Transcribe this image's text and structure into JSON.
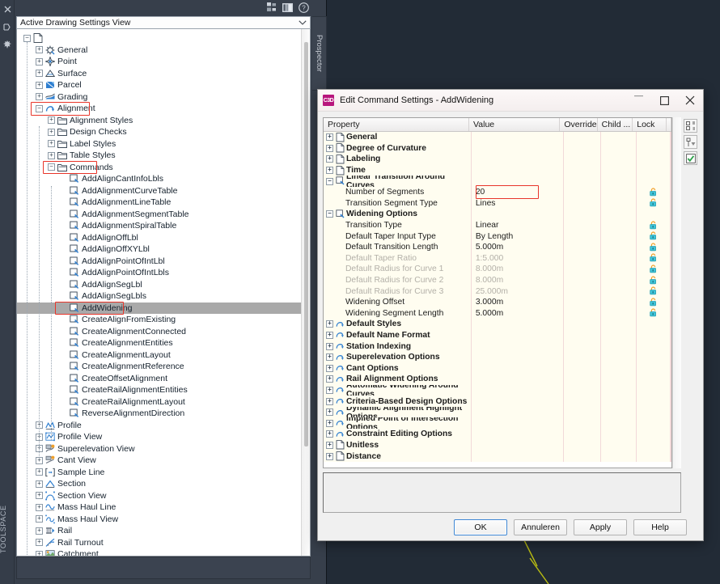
{
  "canvas": {
    "line_color": "#b9bc12"
  },
  "toolspace": {
    "vertical_label": "TOOLSPACE",
    "panel_tab": "Prospector",
    "left_icons": [
      "close-icon",
      "auto-hide-icon",
      "properties-icon"
    ],
    "title_icons": [
      "toolspace-panel-icon",
      "toolspace-view-icon",
      "help-icon"
    ],
    "view_selector": {
      "value": "Active Drawing Settings View",
      "arrow": "chevron-down-icon"
    },
    "tree": [
      {
        "label": "",
        "indent": 0,
        "expander": "minus",
        "icon": "drawing-icon",
        "blurred": true
      },
      {
        "label": "General",
        "indent": 1,
        "expander": "plus",
        "icon": "general-icon"
      },
      {
        "label": "Point",
        "indent": 1,
        "expander": "plus",
        "icon": "point-icon"
      },
      {
        "label": "Surface",
        "indent": 1,
        "expander": "plus",
        "icon": "surface-icon"
      },
      {
        "label": "Parcel",
        "indent": 1,
        "expander": "plus",
        "icon": "parcel-icon"
      },
      {
        "label": "Grading",
        "indent": 1,
        "expander": "plus",
        "icon": "grading-icon"
      },
      {
        "label": "Alignment",
        "indent": 1,
        "expander": "minus",
        "icon": "alignment-icon",
        "highlight": true
      },
      {
        "label": "Alignment Styles",
        "indent": 2,
        "expander": "plus",
        "icon": "folder-icon"
      },
      {
        "label": "Design Checks",
        "indent": 2,
        "expander": "plus",
        "icon": "folder-icon"
      },
      {
        "label": "Label Styles",
        "indent": 2,
        "expander": "plus",
        "icon": "folder-icon"
      },
      {
        "label": "Table Styles",
        "indent": 2,
        "expander": "plus",
        "icon": "folder-icon"
      },
      {
        "label": "Commands",
        "indent": 2,
        "expander": "minus",
        "icon": "folder-icon",
        "highlight": true
      },
      {
        "label": "AddAlignCantInfoLbls",
        "indent": 3,
        "expander": "none",
        "icon": "command-icon"
      },
      {
        "label": "AddAlignmentCurveTable",
        "indent": 3,
        "expander": "none",
        "icon": "command-icon"
      },
      {
        "label": "AddAlignmentLineTable",
        "indent": 3,
        "expander": "none",
        "icon": "command-icon"
      },
      {
        "label": "AddAlignmentSegmentTable",
        "indent": 3,
        "expander": "none",
        "icon": "command-icon"
      },
      {
        "label": "AddAlignmentSpiralTable",
        "indent": 3,
        "expander": "none",
        "icon": "command-icon"
      },
      {
        "label": "AddAlignOffLbl",
        "indent": 3,
        "expander": "none",
        "icon": "command-icon"
      },
      {
        "label": "AddAlignOffXYLbl",
        "indent": 3,
        "expander": "none",
        "icon": "command-icon"
      },
      {
        "label": "AddAlignPointOfIntLbl",
        "indent": 3,
        "expander": "none",
        "icon": "command-icon"
      },
      {
        "label": "AddAlignPointOfIntLbls",
        "indent": 3,
        "expander": "none",
        "icon": "command-icon"
      },
      {
        "label": "AddAlignSegLbl",
        "indent": 3,
        "expander": "none",
        "icon": "command-icon"
      },
      {
        "label": "AddAlignSegLbls",
        "indent": 3,
        "expander": "none",
        "icon": "command-icon"
      },
      {
        "label": "AddWidening",
        "indent": 3,
        "expander": "none",
        "icon": "command-icon",
        "selected": true,
        "highlight": true
      },
      {
        "label": "CreateAlignFromExisting",
        "indent": 3,
        "expander": "none",
        "icon": "command-icon"
      },
      {
        "label": "CreateAlignmentConnected",
        "indent": 3,
        "expander": "none",
        "icon": "command-icon"
      },
      {
        "label": "CreateAlignmentEntities",
        "indent": 3,
        "expander": "none",
        "icon": "command-icon"
      },
      {
        "label": "CreateAlignmentLayout",
        "indent": 3,
        "expander": "none",
        "icon": "command-icon"
      },
      {
        "label": "CreateAlignmentReference",
        "indent": 3,
        "expander": "none",
        "icon": "command-icon"
      },
      {
        "label": "CreateOffsetAlignment",
        "indent": 3,
        "expander": "none",
        "icon": "command-icon"
      },
      {
        "label": "CreateRailAlignmentEntities",
        "indent": 3,
        "expander": "none",
        "icon": "command-icon"
      },
      {
        "label": "CreateRailAlignmentLayout",
        "indent": 3,
        "expander": "none",
        "icon": "command-icon"
      },
      {
        "label": "ReverseAlignmentDirection",
        "indent": 3,
        "expander": "none",
        "icon": "command-icon"
      },
      {
        "label": "Profile",
        "indent": 1,
        "expander": "plus",
        "icon": "profile-icon"
      },
      {
        "label": "Profile View",
        "indent": 1,
        "expander": "plus",
        "icon": "profile-view-icon"
      },
      {
        "label": "Superelevation View",
        "indent": 1,
        "expander": "plus",
        "icon": "superelevation-view-icon"
      },
      {
        "label": "Cant View",
        "indent": 1,
        "expander": "plus",
        "icon": "cant-view-icon"
      },
      {
        "label": "Sample Line",
        "indent": 1,
        "expander": "plus",
        "icon": "sample-line-icon"
      },
      {
        "label": "Section",
        "indent": 1,
        "expander": "plus",
        "icon": "section-icon"
      },
      {
        "label": "Section View",
        "indent": 1,
        "expander": "plus",
        "icon": "section-view-icon"
      },
      {
        "label": "Mass Haul Line",
        "indent": 1,
        "expander": "plus",
        "icon": "mass-haul-line-icon"
      },
      {
        "label": "Mass Haul View",
        "indent": 1,
        "expander": "plus",
        "icon": "mass-haul-view-icon"
      },
      {
        "label": "Rail",
        "indent": 1,
        "expander": "plus",
        "icon": "rail-icon"
      },
      {
        "label": "Rail Turnout",
        "indent": 1,
        "expander": "plus",
        "icon": "rail-turnout-icon"
      },
      {
        "label": "Catchment",
        "indent": 1,
        "expander": "plus",
        "icon": "catchment-icon"
      }
    ]
  },
  "dialog": {
    "title": "Edit Command Settings - AddWidening",
    "app_badge": "C3D",
    "window_buttons": [
      {
        "name": "minimize-button",
        "glyph": "minimize-icon"
      },
      {
        "name": "maximize-button",
        "glyph": "maximize-icon"
      },
      {
        "name": "close-button",
        "glyph": "close-icon"
      }
    ],
    "columns": [
      "Property",
      "Value",
      "Override",
      "Child ...",
      "Lock"
    ],
    "rows": [
      {
        "property": "General",
        "value": "",
        "level": "cat",
        "expander": "plus",
        "icon": "page-icon"
      },
      {
        "property": "Degree of Curvature",
        "value": "",
        "level": "cat",
        "expander": "plus",
        "icon": "page-icon"
      },
      {
        "property": "Labeling",
        "value": "",
        "level": "cat",
        "expander": "plus",
        "icon": "page-icon"
      },
      {
        "property": "Time",
        "value": "",
        "level": "cat",
        "expander": "plus",
        "icon": "page-icon"
      },
      {
        "property": "Linear Transition Around Curves",
        "value": "",
        "level": "cat",
        "expander": "minus",
        "icon": "command-page-icon"
      },
      {
        "property": "Number of Segments",
        "value": "20",
        "level": "item",
        "lock": true,
        "value_highlight": true
      },
      {
        "property": "Transition Segment Type",
        "value": "Lines",
        "level": "item",
        "lock": true
      },
      {
        "property": "Widening Options",
        "value": "",
        "level": "cat",
        "expander": "minus",
        "icon": "command-page-icon"
      },
      {
        "property": "Transition Type",
        "value": "Linear",
        "level": "item",
        "lock": true
      },
      {
        "property": "Default Taper Input Type",
        "value": "By Length",
        "level": "item",
        "lock": true
      },
      {
        "property": "Default Transition Length",
        "value": "5.000m",
        "level": "item",
        "lock": true
      },
      {
        "property": "Default Taper Ratio",
        "value": "1:5.000",
        "level": "item",
        "dim": true,
        "lock": true
      },
      {
        "property": "Default Radius for Curve 1",
        "value": "8.000m",
        "level": "item",
        "dim": true,
        "lock": true
      },
      {
        "property": "Default Radius for Curve 2",
        "value": "8.000m",
        "level": "item",
        "dim": true,
        "lock": true
      },
      {
        "property": "Default Radius for Curve 3",
        "value": "25.000m",
        "level": "item",
        "dim": true,
        "lock": true
      },
      {
        "property": "Widening Offset",
        "value": "3.000m",
        "level": "item",
        "lock": true
      },
      {
        "property": "Widening Segment Length",
        "value": "5.000m",
        "level": "item",
        "lock": true
      },
      {
        "property": "Default Styles",
        "value": "",
        "level": "cat",
        "expander": "plus",
        "icon": "alignment-small-icon"
      },
      {
        "property": "Default Name Format",
        "value": "",
        "level": "cat",
        "expander": "plus",
        "icon": "alignment-small-icon"
      },
      {
        "property": "Station Indexing",
        "value": "",
        "level": "cat",
        "expander": "plus",
        "icon": "alignment-small-icon"
      },
      {
        "property": "Superelevation Options",
        "value": "",
        "level": "cat",
        "expander": "plus",
        "icon": "alignment-small-icon"
      },
      {
        "property": "Cant Options",
        "value": "",
        "level": "cat",
        "expander": "plus",
        "icon": "alignment-small-icon"
      },
      {
        "property": "Rail Alignment Options",
        "value": "",
        "level": "cat",
        "expander": "plus",
        "icon": "alignment-small-icon"
      },
      {
        "property": "Automatic Widening Around Curves",
        "value": "",
        "level": "cat",
        "expander": "plus",
        "icon": "alignment-small-icon"
      },
      {
        "property": "Criteria-Based Design Options",
        "value": "",
        "level": "cat",
        "expander": "plus",
        "icon": "alignment-small-icon"
      },
      {
        "property": "Dynamic Alignment Highlight Options",
        "value": "",
        "level": "cat",
        "expander": "plus",
        "icon": "alignment-small-icon"
      },
      {
        "property": "Implied Point of Intersection Options",
        "value": "",
        "level": "cat",
        "expander": "plus",
        "icon": "alignment-small-icon"
      },
      {
        "property": "Constraint Editing Options",
        "value": "",
        "level": "cat",
        "expander": "plus",
        "icon": "alignment-small-icon"
      },
      {
        "property": "Unitless",
        "value": "",
        "level": "cat",
        "expander": "plus",
        "icon": "page-icon"
      },
      {
        "property": "Distance",
        "value": "",
        "level": "cat",
        "expander": "plus",
        "icon": "page-icon"
      }
    ],
    "side_tools": [
      {
        "name": "expand-collapse-tool",
        "glyph": "tree-expand-icon"
      },
      {
        "name": "filter-tool",
        "glyph": "filter-icon"
      },
      {
        "name": "check-tool",
        "glyph": "checkbox-icon"
      }
    ],
    "description_panel": "",
    "buttons": [
      {
        "label": "OK",
        "name": "ok-button",
        "primary": true
      },
      {
        "label": "Annuleren",
        "name": "cancel-button",
        "primary": false
      },
      {
        "label": "Apply",
        "name": "apply-button",
        "primary": false
      },
      {
        "label": "Help",
        "name": "help-button",
        "primary": false
      }
    ]
  },
  "annotations": {
    "color": "#e8352a"
  }
}
